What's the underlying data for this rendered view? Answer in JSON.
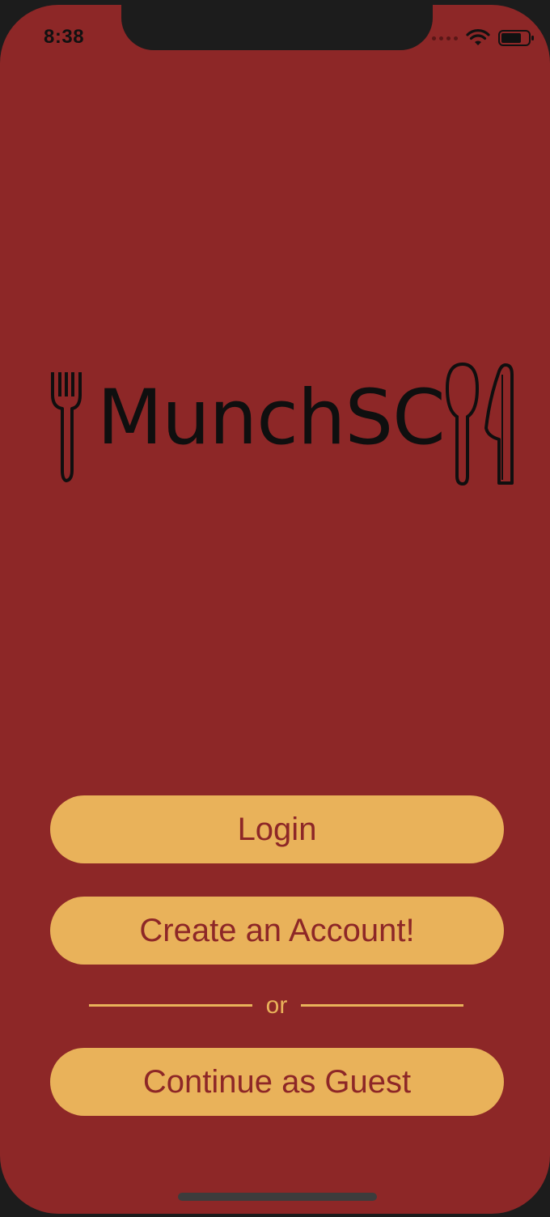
{
  "status_bar": {
    "time": "8:38"
  },
  "brand": {
    "name": "MunchSC"
  },
  "actions": {
    "login_label": "Login",
    "create_label": "Create an Account!",
    "divider_text": "or",
    "guest_label": "Continue as Guest"
  },
  "colors": {
    "background": "#8d2727",
    "button": "#e9b25a",
    "button_text": "#8d2727",
    "device_frame": "#1c1c1c"
  },
  "icons": [
    "fork-icon",
    "spoon-icon",
    "knife-icon",
    "wifi-icon",
    "battery-icon",
    "cellular-signal-icon"
  ]
}
